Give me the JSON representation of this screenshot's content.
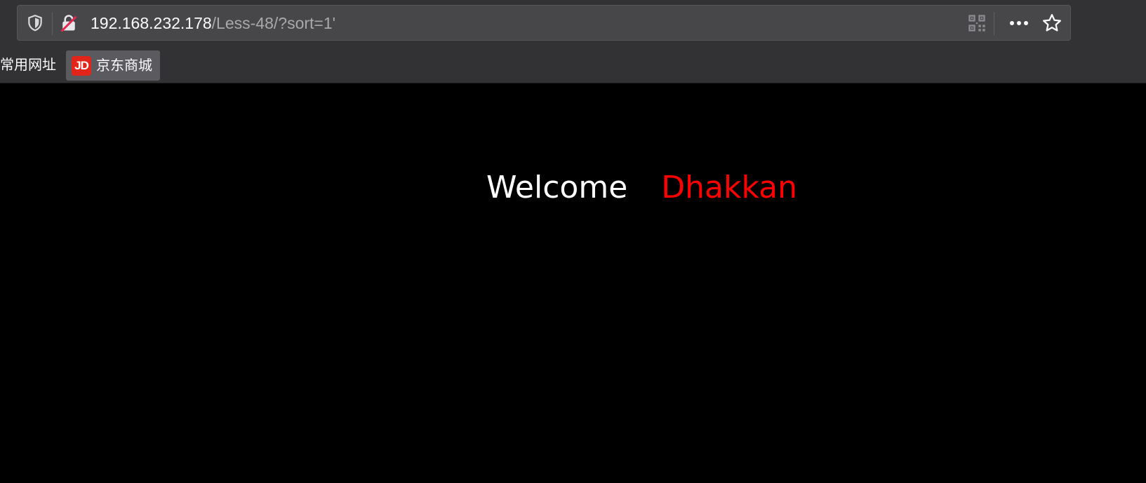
{
  "browser": {
    "url_host": "192.168.232.178",
    "url_path": "/Less-48/?sort=1'",
    "icons": {
      "tracking_protection": "shield-icon",
      "connection": "insecure-lock-icon",
      "qr_code": "qr-code-icon",
      "page_actions": "more-icon",
      "bookmark": "star-icon"
    }
  },
  "bookmarks_bar": {
    "folder_label": "常用网址",
    "items": [
      {
        "logo_text": "JD",
        "label": "京东商城",
        "logo_color": "#e1251b"
      }
    ]
  },
  "page": {
    "welcome_text": "Welcome",
    "name_text": "Dhakkan",
    "name_color": "#ff0000",
    "background": "#000000"
  }
}
